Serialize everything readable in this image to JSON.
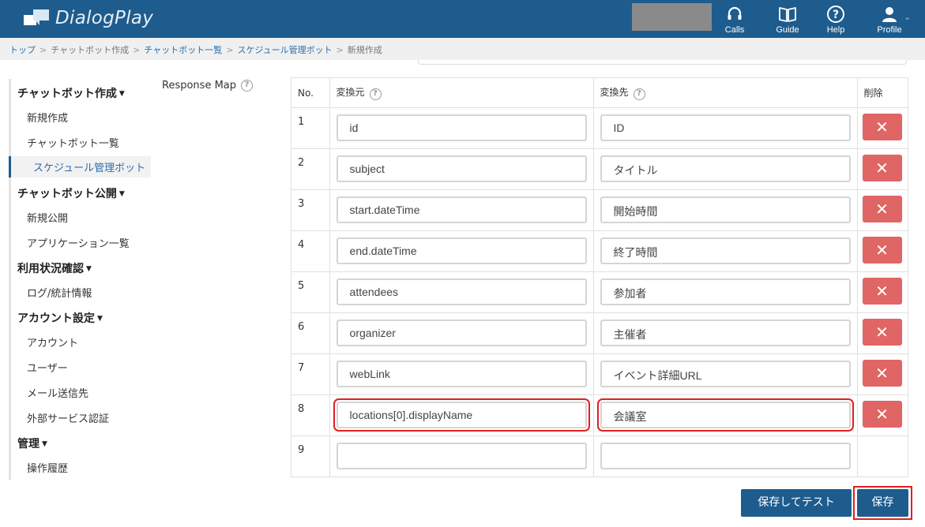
{
  "header": {
    "app_name": "DialogPlay",
    "nav": [
      {
        "label": "Calls",
        "icon": "headset-icon"
      },
      {
        "label": "Guide",
        "icon": "book-icon"
      },
      {
        "label": "Help",
        "icon": "question-circle-icon"
      },
      {
        "label": "Profile",
        "icon": "user-icon"
      }
    ]
  },
  "breadcrumb": [
    "トップ",
    "チャットボット作成",
    "チャットボット一覧",
    "スケジュール管理ボット",
    "新規作成"
  ],
  "sidebar": {
    "sections": [
      {
        "title": "チャットボット作成",
        "items": [
          "新規作成",
          "チャットボット一覧",
          "スケジュール管理ボット"
        ]
      },
      {
        "title": "チャットボット公開",
        "items": [
          "新規公開",
          "アプリケーション一覧"
        ]
      },
      {
        "title": "利用状況確認",
        "items": [
          "ログ/統計情報"
        ]
      },
      {
        "title": "アカウント設定",
        "items": [
          "アカウント",
          "ユーザー",
          "メール送信先",
          "外部サービス認証"
        ]
      },
      {
        "title": "管理",
        "items": [
          "操作履歴"
        ]
      }
    ],
    "active_item": "スケジュール管理ボット"
  },
  "response_map": {
    "label": "Response Map",
    "columns": {
      "no": "No.",
      "source": "変換元",
      "target": "変換先",
      "delete": "削除"
    },
    "rows": [
      {
        "no": "1",
        "source": "id",
        "target": "ID"
      },
      {
        "no": "2",
        "source": "subject",
        "target": "タイトル"
      },
      {
        "no": "3",
        "source": "start.dateTime",
        "target": "開始時間"
      },
      {
        "no": "4",
        "source": "end.dateTime",
        "target": "終了時間"
      },
      {
        "no": "5",
        "source": "attendees",
        "target": "参加者"
      },
      {
        "no": "6",
        "source": "organizer",
        "target": "主催者"
      },
      {
        "no": "7",
        "source": "webLink",
        "target": "イベント詳細URL"
      },
      {
        "no": "8",
        "source": "locations[0].displayName",
        "target": "会議室"
      },
      {
        "no": "9",
        "source": "",
        "target": ""
      }
    ],
    "delete_symbol": "✕"
  },
  "actions": {
    "save_and_test": "保存してテスト",
    "save": "保存"
  },
  "colors": {
    "header": "#1e5c8e",
    "delete_button": "#e06565",
    "highlight": "#e02020"
  }
}
